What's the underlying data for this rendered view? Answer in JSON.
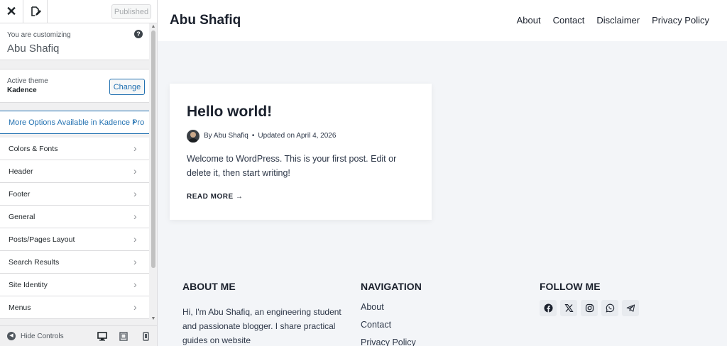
{
  "customizer": {
    "publish_label": "Published",
    "customizing_label": "You are customizing",
    "site_title": "Abu Shafiq",
    "active_theme_label": "Active theme",
    "theme_name": "Kadence",
    "change_label": "Change",
    "pro_label": "More Options Available in Kadence Pro",
    "menu_items": [
      {
        "label": "Colors & Fonts"
      },
      {
        "label": "Header"
      },
      {
        "label": "Footer"
      },
      {
        "label": "General"
      },
      {
        "label": "Posts/Pages Layout"
      },
      {
        "label": "Search Results"
      },
      {
        "label": "Site Identity"
      },
      {
        "label": "Menus"
      }
    ],
    "hide_controls_label": "Hide Controls"
  },
  "site": {
    "title": "Abu Shafiq",
    "nav": [
      "About",
      "Contact",
      "Disclaimer",
      "Privacy Policy"
    ]
  },
  "post": {
    "title": "Hello world!",
    "author": "By Abu Shafiq",
    "separator": "•",
    "updated": "Updated on April 4, 2026",
    "excerpt": "Welcome to WordPress. This is your first post. Edit or delete it, then start writing!",
    "read_more": "READ MORE →"
  },
  "footer": {
    "about_heading": "ABOUT ME",
    "about_text": "Hi, I'm Abu Shafiq, an engineering student and passionate blogger. I share practical guides on website",
    "navigation_heading": "NAVIGATION",
    "navigation_links": [
      "About",
      "Contact",
      "Privacy Policy"
    ],
    "follow_heading": "FOLLOW ME",
    "social_icons": [
      "facebook-icon",
      "x-icon",
      "instagram-icon",
      "whatsapp-icon",
      "telegram-icon"
    ]
  },
  "colors": {
    "accent": "#2271b1",
    "panel_bg": "#f0f0f1",
    "preview_bg": "#f3f5f8"
  }
}
